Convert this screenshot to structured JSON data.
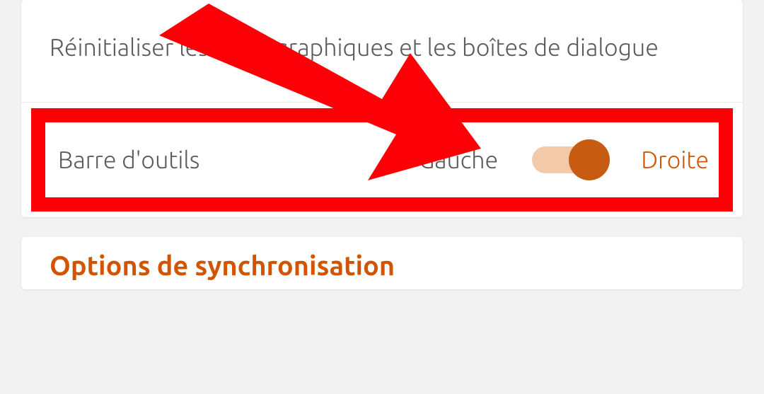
{
  "reset": {
    "label": "Réinitialiser les aides graphiques et les boîtes de dialogue"
  },
  "toolbar": {
    "label": "Barre d'outils",
    "option_left": "Gauche",
    "option_right": "Droite",
    "toggle_state": "right"
  },
  "sync": {
    "title": "Options de synchronisation"
  },
  "colors": {
    "accent": "#d35400",
    "highlight_red": "#fb0007"
  }
}
